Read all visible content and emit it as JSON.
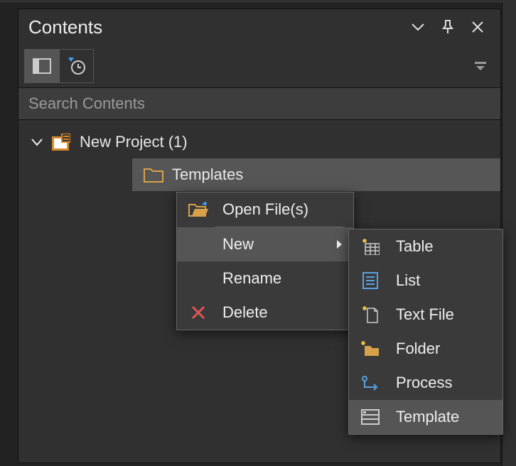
{
  "panel": {
    "title": "Contents"
  },
  "search": {
    "placeholder": "Search Contents"
  },
  "tree": {
    "root": {
      "label": "New Project (1)"
    },
    "child": {
      "label": "Templates"
    }
  },
  "contextMenu": {
    "open": "Open File(s)",
    "new": "New",
    "rename": "Rename",
    "delete": "Delete"
  },
  "submenu": {
    "table": "Table",
    "list": "List",
    "textfile": "Text File",
    "folder": "Folder",
    "process": "Process",
    "template": "Template"
  }
}
